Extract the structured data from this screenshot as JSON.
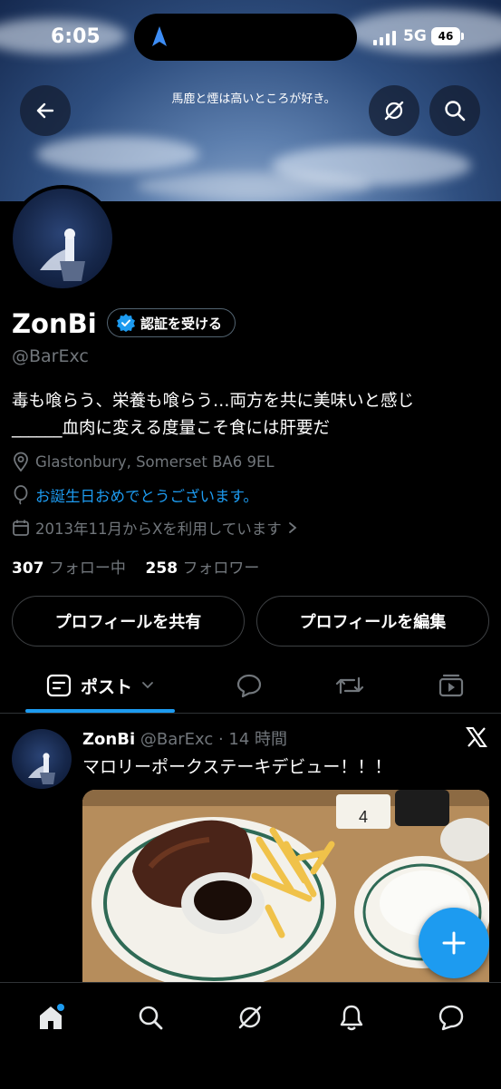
{
  "status_bar": {
    "time": "6:05",
    "network": "5G",
    "battery": "46"
  },
  "header": {
    "banner_title": "馬鹿と煙は高いところが好き。"
  },
  "profile": {
    "name": "ZonBi",
    "verify_label": "認証を受ける",
    "handle": "@BarExc",
    "bio_line1": "毒も喰らう、栄養も喰らう…両方を共に美味いと感じ",
    "bio_line2": "______血肉に変える度量こそ食には肝要だ",
    "location": "Glastonbury, Somerset BA6 9EL",
    "birthday": "お誕生日おめでとうございます。",
    "joined": "2013年11月からXを利用しています",
    "following_count": "307",
    "following_label": "フォロー中",
    "followers_count": "258",
    "followers_label": "フォロワー",
    "share_button": "プロフィールを共有",
    "edit_button": "プロフィールを編集"
  },
  "tabs": {
    "posts_label": "ポスト"
  },
  "post": {
    "name": "ZonBi",
    "handle_time": "@BarExc · 14 時間",
    "text": "マロリーポークステーキデビュー！！！"
  },
  "colors": {
    "accent": "#1d9bf0",
    "background": "#000000",
    "muted": "#71767b"
  }
}
